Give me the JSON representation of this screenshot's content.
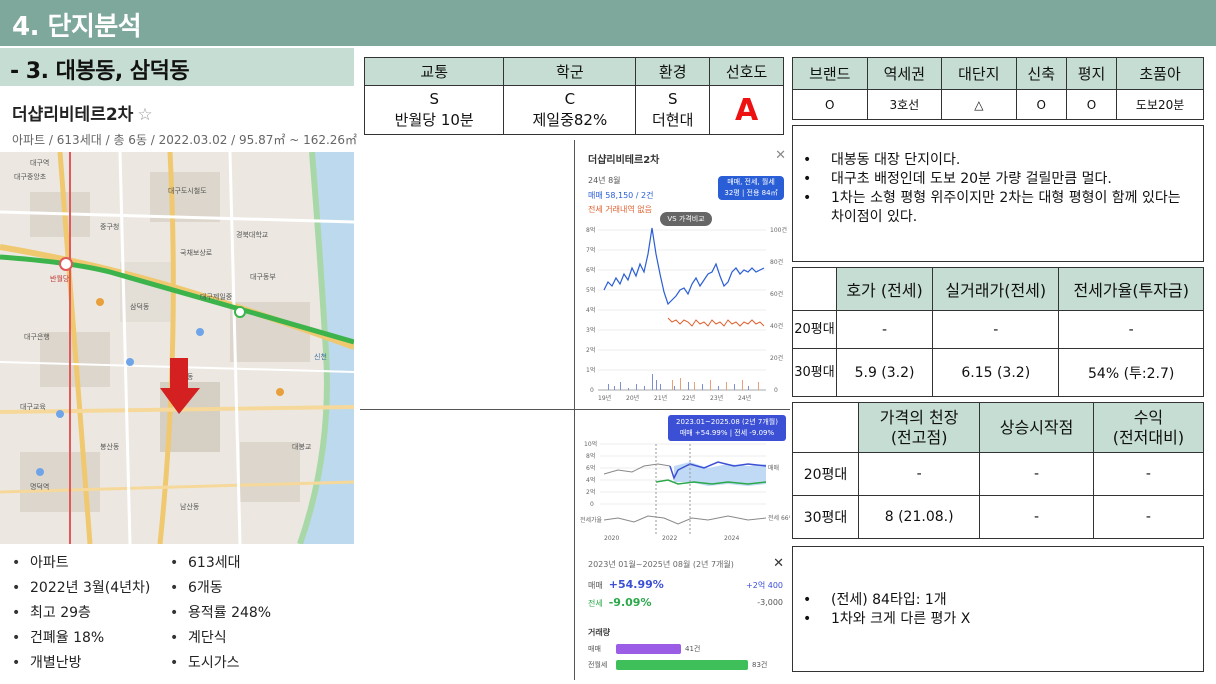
{
  "header": {
    "title": "4. 단지분석"
  },
  "section": {
    "title": "- 3. 대봉동, 삼덕동"
  },
  "apartment": {
    "name": "더샵리비테르2차",
    "star": "☆",
    "info": "아파트 / 613세대 / 총 6동 / 2022.03.02 / 95.87㎡ ~ 162.26㎡"
  },
  "map": {
    "labels": [
      "대구중앙초",
      "대구도시철도",
      "경북대학교",
      "대구동부",
      "반월당",
      "대봉동",
      "대봉교",
      "삼덕동",
      "대구제일중",
      "대구은행",
      "신천",
      "중구청",
      "대구교육",
      "봉산동",
      "대구역",
      "국채보상로",
      "명덕역",
      "남산동"
    ],
    "marker_icon": "red-arrow-icon"
  },
  "facts": {
    "left": [
      "아파트",
      "2022년 3월(4년차)",
      "최고 29층",
      "건폐율 18%",
      "개별난방"
    ],
    "right": [
      "613세대",
      "6개동",
      "용적률 248%",
      "계단식",
      "도시가스"
    ]
  },
  "grades": {
    "headers": [
      "교통",
      "학군",
      "환경",
      "선호도"
    ],
    "grade": [
      "S",
      "C",
      "S",
      "A"
    ],
    "detail": [
      "반월당 10분",
      "제일중82%",
      "더현대",
      ""
    ]
  },
  "features": {
    "headers": [
      "브랜드",
      "역세권",
      "대단지",
      "신축",
      "평지",
      "초품아"
    ],
    "values": [
      "O",
      "3호선",
      "△",
      "O",
      "O",
      "도보20분"
    ]
  },
  "notes": [
    "대봉동 대장 단지이다.",
    "대구초 배정인데 도보 20분 가량 걸릴만큼 멀다.",
    "1차는 소형 평형 위주이지만 2차는 대형 평형이 함께 있다는 차이점이 있다."
  ],
  "price_table": {
    "headers": [
      "호가 (전세)",
      "실거래가(전세)",
      "전세가율(투자금)"
    ],
    "rows": [
      {
        "label": "20평대",
        "cells": [
          "-",
          "-",
          "-"
        ]
      },
      {
        "label": "30평대",
        "cells": [
          "5.9 (3.2)",
          "6.15 (3.2)",
          "54% (투:2.7)"
        ]
      }
    ]
  },
  "ceiling_table": {
    "headers": [
      "가격의 천장\n(전고점)",
      "상승시작점",
      "수익\n(전저대비)"
    ],
    "headers_l1": [
      "가격의 천장",
      "상승시작점",
      "수익"
    ],
    "headers_l2": [
      "(전고점)",
      "",
      "(전저대비)"
    ],
    "rows": [
      {
        "label": "20평대",
        "cells": [
          "-",
          "-",
          "-"
        ]
      },
      {
        "label": "30평대",
        "cells": [
          "8 (21.08.)",
          "-",
          "-"
        ]
      }
    ]
  },
  "notes2": [
    "(전세) 84타입: 1개",
    "1차와 크게 다른 평가 X"
  ],
  "panel_trade": {
    "name": "더샵리비테르2차",
    "date": "24년 8월",
    "sale": "매매 58,150 / 2건",
    "jeonse": "전세 거래내역 없음",
    "dropdown_l1": "매매, 전세, 월세",
    "dropdown_l2": "32평 | 전용 84㎡",
    "vs_button": "VS 가격비교",
    "y_left": [
      "8억",
      "7억",
      "6억",
      "5억",
      "4억",
      "3억",
      "2억",
      "1억",
      "0"
    ],
    "y_right": [
      "100건",
      "80건",
      "60건",
      "40건",
      "20건",
      "0"
    ],
    "x": [
      "19년",
      "20년",
      "21년",
      "22년",
      "23년",
      "24년"
    ]
  },
  "panel_compare": {
    "banner_l1": "2023.01~2025.08 (2년 7개월)",
    "banner_l2": "매매 +54.99% | 전세 -9.09%",
    "y": [
      "10억",
      "8억",
      "6억",
      "4억",
      "2억",
      "0"
    ],
    "x": [
      "2020",
      "2022",
      "2024"
    ],
    "side_label": "전세가율",
    "compare_label": "매매",
    "pct_label": "전세 66%"
  },
  "panel_summary": {
    "heading": "2023년 01월~2025년 08월 (2년 7개월)",
    "sale_label": "매매",
    "sale_pct": "+54.99%",
    "sale_amt": "+2억 400",
    "jeonse_label": "전세",
    "jeonse_pct": "-9.09%",
    "jeonse_amt": "-3,000",
    "volume_title": "거래량",
    "bars": [
      {
        "label": "매매",
        "count": "41건",
        "value": 41,
        "color": "#9b5de5"
      },
      {
        "label": "전월세",
        "count": "83건",
        "value": 83,
        "color": "#3fbf5a"
      }
    ]
  },
  "colors": {
    "header": "#7fa89c",
    "subheader": "#c5ddd2",
    "grade_a": "#e11111",
    "sale_line": "#2a5ed6",
    "jeonse_line": "#e06030"
  }
}
